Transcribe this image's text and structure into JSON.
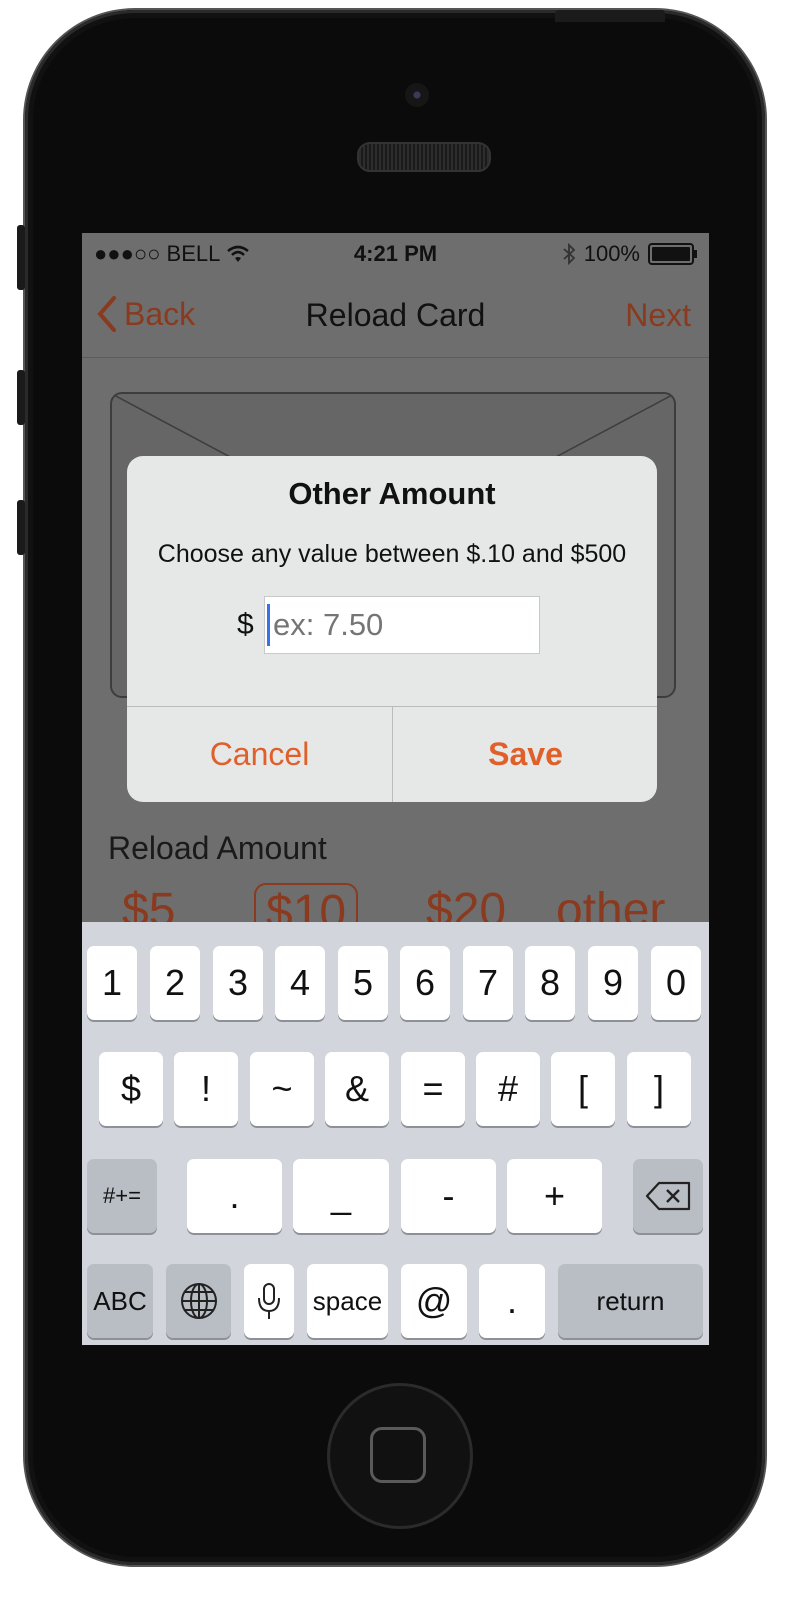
{
  "status_bar": {
    "carrier": "●●●○○ BELL",
    "time": "4:21 PM",
    "battery": "100%"
  },
  "nav": {
    "back_label": "Back",
    "title": "Reload Card",
    "next_label": "Next"
  },
  "reload": {
    "label": "Reload Amount",
    "amounts": [
      "$5",
      "$10",
      "$20",
      "other"
    ],
    "selected": "$10"
  },
  "dialog": {
    "title": "Other Amount",
    "message": "Choose any value between $.10 and $500",
    "currency_symbol": "$",
    "input_placeholder": "ex: 7.50",
    "input_value": "",
    "cancel_label": "Cancel",
    "save_label": "Save"
  },
  "keyboard": {
    "row1": [
      "1",
      "2",
      "3",
      "4",
      "5",
      "6",
      "7",
      "8",
      "9",
      "0"
    ],
    "row2": [
      "$",
      "!",
      "~",
      "&",
      "=",
      "#",
      "[",
      "]"
    ],
    "row3": [
      "#+=",
      ".",
      "_",
      "-",
      "+"
    ],
    "row4": [
      "ABC",
      "space",
      "@",
      ".",
      "return"
    ]
  },
  "colors": {
    "accent": "#e0602a",
    "accent_dimmed": "#8a3a1e",
    "dialog_bg": "#e6e8e8",
    "keyboard_bg": "#d2d5db"
  },
  "icons": {
    "wifi": "wifi-icon",
    "bluetooth": "bluetooth-icon",
    "battery": "battery-icon",
    "back": "chevron-left-icon",
    "globe": "globe-icon",
    "mic": "microphone-icon",
    "delete": "backspace-icon"
  }
}
